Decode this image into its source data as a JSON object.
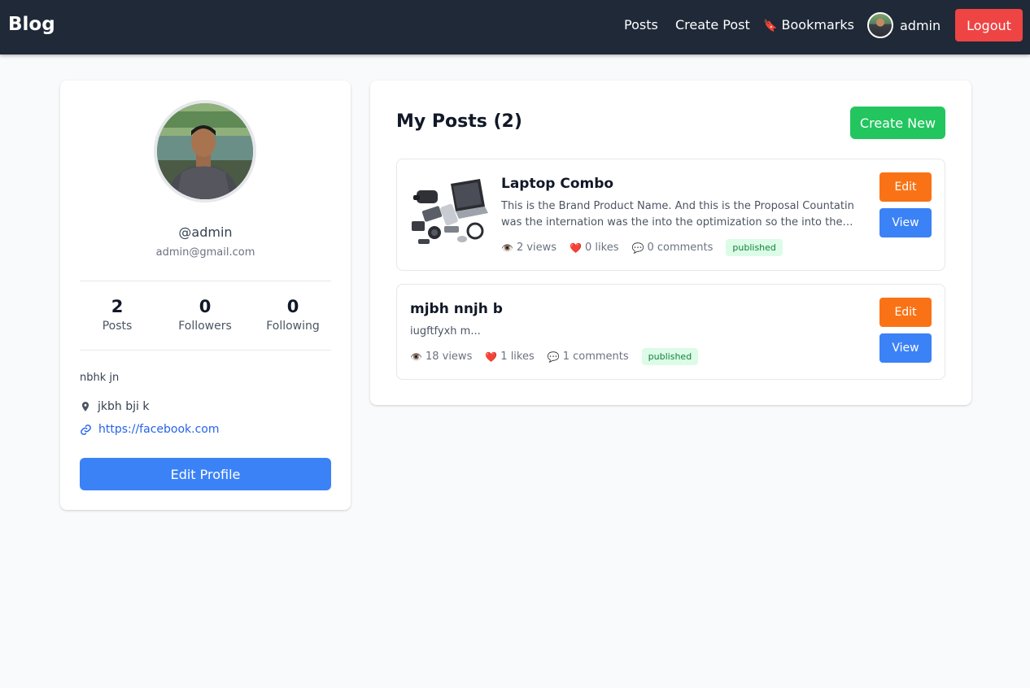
{
  "nav": {
    "brand": "Blog",
    "links": [
      "Posts",
      "Create Post",
      "Bookmarks"
    ],
    "bookmark_icon": "🔖",
    "user_name": "admin",
    "logout_label": "Logout"
  },
  "profile": {
    "username": "@admin",
    "email": "admin@gmail.com",
    "stats": [
      {
        "value": "2",
        "label": "Posts"
      },
      {
        "value": "0",
        "label": "Followers"
      },
      {
        "value": "0",
        "label": "Following"
      }
    ],
    "bio": "nbhk jn",
    "location": "jkbh bji k",
    "website": "https://facebook.com",
    "edit_label": "Edit Profile"
  },
  "posts_section": {
    "title": "My Posts (2)",
    "create_label": "Create New",
    "posts": [
      {
        "title": "Laptop Combo",
        "excerpt": "This is the Brand Product Name. And this is the Proposal Countatin was the internation was the into the optimization so the into the internet....",
        "views": "2 views",
        "likes": "0 likes",
        "comments": "0 comments",
        "status": "published",
        "edit_label": "Edit",
        "view_label": "View"
      },
      {
        "title": "mjbh nnjh b",
        "excerpt": "iugftfyxh m...",
        "views": "18 views",
        "likes": "1 likes",
        "comments": "1 comments",
        "status": "published",
        "edit_label": "Edit",
        "view_label": "View"
      }
    ]
  },
  "icons": {
    "views": "👁️",
    "likes": "❤️",
    "comments": "💬"
  },
  "colors": {
    "navbar": "#1f2937",
    "logout": "#ef4444",
    "primary": "#3b82f6",
    "create": "#22c55e",
    "edit": "#f97316",
    "badge_bg": "#dcfce7",
    "badge_text": "#15803d",
    "page_bg": "#f9fafb"
  }
}
